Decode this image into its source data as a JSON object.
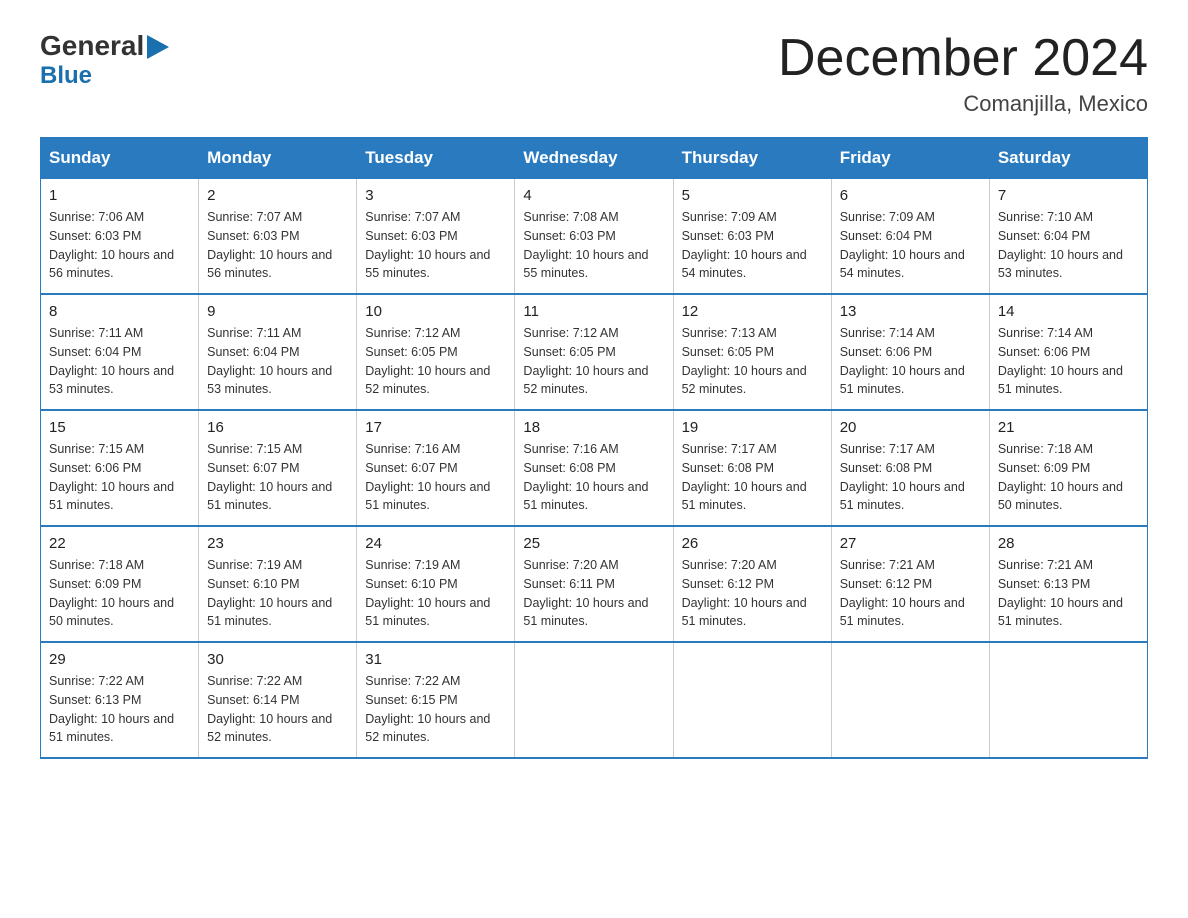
{
  "header": {
    "title": "December 2024",
    "subtitle": "Comanjilla, Mexico",
    "logo_general": "General",
    "logo_blue": "Blue"
  },
  "days_of_week": [
    "Sunday",
    "Monday",
    "Tuesday",
    "Wednesday",
    "Thursday",
    "Friday",
    "Saturday"
  ],
  "weeks": [
    [
      {
        "day": "1",
        "sunrise": "7:06 AM",
        "sunset": "6:03 PM",
        "daylight": "10 hours and 56 minutes."
      },
      {
        "day": "2",
        "sunrise": "7:07 AM",
        "sunset": "6:03 PM",
        "daylight": "10 hours and 56 minutes."
      },
      {
        "day": "3",
        "sunrise": "7:07 AM",
        "sunset": "6:03 PM",
        "daylight": "10 hours and 55 minutes."
      },
      {
        "day": "4",
        "sunrise": "7:08 AM",
        "sunset": "6:03 PM",
        "daylight": "10 hours and 55 minutes."
      },
      {
        "day": "5",
        "sunrise": "7:09 AM",
        "sunset": "6:03 PM",
        "daylight": "10 hours and 54 minutes."
      },
      {
        "day": "6",
        "sunrise": "7:09 AM",
        "sunset": "6:04 PM",
        "daylight": "10 hours and 54 minutes."
      },
      {
        "day": "7",
        "sunrise": "7:10 AM",
        "sunset": "6:04 PM",
        "daylight": "10 hours and 53 minutes."
      }
    ],
    [
      {
        "day": "8",
        "sunrise": "7:11 AM",
        "sunset": "6:04 PM",
        "daylight": "10 hours and 53 minutes."
      },
      {
        "day": "9",
        "sunrise": "7:11 AM",
        "sunset": "6:04 PM",
        "daylight": "10 hours and 53 minutes."
      },
      {
        "day": "10",
        "sunrise": "7:12 AM",
        "sunset": "6:05 PM",
        "daylight": "10 hours and 52 minutes."
      },
      {
        "day": "11",
        "sunrise": "7:12 AM",
        "sunset": "6:05 PM",
        "daylight": "10 hours and 52 minutes."
      },
      {
        "day": "12",
        "sunrise": "7:13 AM",
        "sunset": "6:05 PM",
        "daylight": "10 hours and 52 minutes."
      },
      {
        "day": "13",
        "sunrise": "7:14 AM",
        "sunset": "6:06 PM",
        "daylight": "10 hours and 51 minutes."
      },
      {
        "day": "14",
        "sunrise": "7:14 AM",
        "sunset": "6:06 PM",
        "daylight": "10 hours and 51 minutes."
      }
    ],
    [
      {
        "day": "15",
        "sunrise": "7:15 AM",
        "sunset": "6:06 PM",
        "daylight": "10 hours and 51 minutes."
      },
      {
        "day": "16",
        "sunrise": "7:15 AM",
        "sunset": "6:07 PM",
        "daylight": "10 hours and 51 minutes."
      },
      {
        "day": "17",
        "sunrise": "7:16 AM",
        "sunset": "6:07 PM",
        "daylight": "10 hours and 51 minutes."
      },
      {
        "day": "18",
        "sunrise": "7:16 AM",
        "sunset": "6:08 PM",
        "daylight": "10 hours and 51 minutes."
      },
      {
        "day": "19",
        "sunrise": "7:17 AM",
        "sunset": "6:08 PM",
        "daylight": "10 hours and 51 minutes."
      },
      {
        "day": "20",
        "sunrise": "7:17 AM",
        "sunset": "6:08 PM",
        "daylight": "10 hours and 51 minutes."
      },
      {
        "day": "21",
        "sunrise": "7:18 AM",
        "sunset": "6:09 PM",
        "daylight": "10 hours and 50 minutes."
      }
    ],
    [
      {
        "day": "22",
        "sunrise": "7:18 AM",
        "sunset": "6:09 PM",
        "daylight": "10 hours and 50 minutes."
      },
      {
        "day": "23",
        "sunrise": "7:19 AM",
        "sunset": "6:10 PM",
        "daylight": "10 hours and 51 minutes."
      },
      {
        "day": "24",
        "sunrise": "7:19 AM",
        "sunset": "6:10 PM",
        "daylight": "10 hours and 51 minutes."
      },
      {
        "day": "25",
        "sunrise": "7:20 AM",
        "sunset": "6:11 PM",
        "daylight": "10 hours and 51 minutes."
      },
      {
        "day": "26",
        "sunrise": "7:20 AM",
        "sunset": "6:12 PM",
        "daylight": "10 hours and 51 minutes."
      },
      {
        "day": "27",
        "sunrise": "7:21 AM",
        "sunset": "6:12 PM",
        "daylight": "10 hours and 51 minutes."
      },
      {
        "day": "28",
        "sunrise": "7:21 AM",
        "sunset": "6:13 PM",
        "daylight": "10 hours and 51 minutes."
      }
    ],
    [
      {
        "day": "29",
        "sunrise": "7:22 AM",
        "sunset": "6:13 PM",
        "daylight": "10 hours and 51 minutes."
      },
      {
        "day": "30",
        "sunrise": "7:22 AM",
        "sunset": "6:14 PM",
        "daylight": "10 hours and 52 minutes."
      },
      {
        "day": "31",
        "sunrise": "7:22 AM",
        "sunset": "6:15 PM",
        "daylight": "10 hours and 52 minutes."
      },
      null,
      null,
      null,
      null
    ]
  ]
}
